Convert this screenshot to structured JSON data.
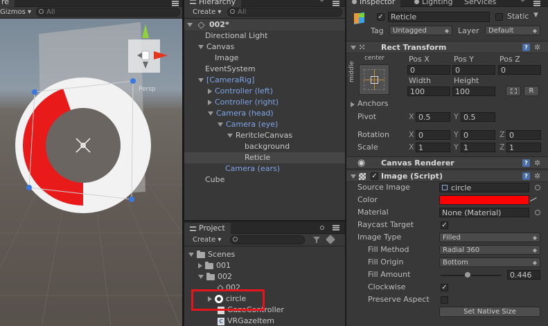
{
  "scene": {
    "tab_label": "re",
    "gizmos_label": "Gizmos",
    "search_placeholder": "All",
    "persp_label": "Persp"
  },
  "hierarchy": {
    "tab_label": "Hierarchy",
    "lighting_tab": "Lighting",
    "services_tab": "Services",
    "create_label": "Create",
    "search_placeholder": "All",
    "scene_name": "002*",
    "items": [
      {
        "label": "Directional Light"
      },
      {
        "label": "Canvas"
      },
      {
        "label": "Image"
      },
      {
        "label": "EventSystem"
      },
      {
        "label": "[CameraRig]"
      },
      {
        "label": "Controller (left)"
      },
      {
        "label": "Controller (right)"
      },
      {
        "label": "Camera (head)"
      },
      {
        "label": "Camera (eye)"
      },
      {
        "label": "ReritcleCanvas"
      },
      {
        "label": "background"
      },
      {
        "label": "Reticle"
      },
      {
        "label": "Camera (ears)"
      },
      {
        "label": "Cube"
      }
    ]
  },
  "project": {
    "tab_label": "Project",
    "create_label": "Create",
    "items": [
      {
        "label": "Scenes"
      },
      {
        "label": "001"
      },
      {
        "label": "002"
      },
      {
        "label": "002"
      },
      {
        "label": "circle"
      },
      {
        "label": "GazeController"
      },
      {
        "label": "VRGazeItem"
      }
    ],
    "highlight_color": "#e8141c"
  },
  "inspector": {
    "tab_label": "Inspector",
    "object_name": "Reticle",
    "static_label": "Static",
    "tag_label": "Tag",
    "tag_value": "Untagged",
    "layer_label": "Layer",
    "layer_value": "Default",
    "rect_transform": {
      "title": "Rect Transform",
      "anchor_h": "center",
      "anchor_v": "middle",
      "pos_x_label": "Pos X",
      "pos_x": "0",
      "pos_y_label": "Pos Y",
      "pos_y": "0",
      "pos_z_label": "Pos Z",
      "pos_z": "0",
      "width_label": "Width",
      "width": "100",
      "height_label": "Height",
      "height": "100",
      "raw_button": "R",
      "anchors_label": "Anchors",
      "pivot_label": "Pivot",
      "pivot_x": "0.5",
      "pivot_y": "0.5",
      "rotation_label": "Rotation",
      "rot_x": "0",
      "rot_y": "0",
      "rot_z": "0",
      "scale_label": "Scale",
      "scale_x": "1",
      "scale_y": "1",
      "scale_z": "1",
      "x": "X",
      "y": "Y",
      "z": "Z"
    },
    "canvas_renderer": {
      "title": "Canvas Renderer"
    },
    "image": {
      "title": "Image (Script)",
      "source_image_label": "Source Image",
      "source_image": "circle",
      "color_label": "Color",
      "color": "#ff0000",
      "material_label": "Material",
      "material": "None (Material)",
      "raycast_label": "Raycast Target",
      "image_type_label": "Image Type",
      "image_type": "Filled",
      "fill_method_label": "Fill Method",
      "fill_method": "Radial 360",
      "fill_origin_label": "Fill Origin",
      "fill_origin": "Bottom",
      "fill_amount_label": "Fill Amount",
      "fill_amount": "0.446",
      "fill_amount_value": 0.446,
      "clockwise_label": "Clockwise",
      "preserve_aspect_label": "Preserve Aspect",
      "native_size_button": "Set Native Size"
    }
  }
}
